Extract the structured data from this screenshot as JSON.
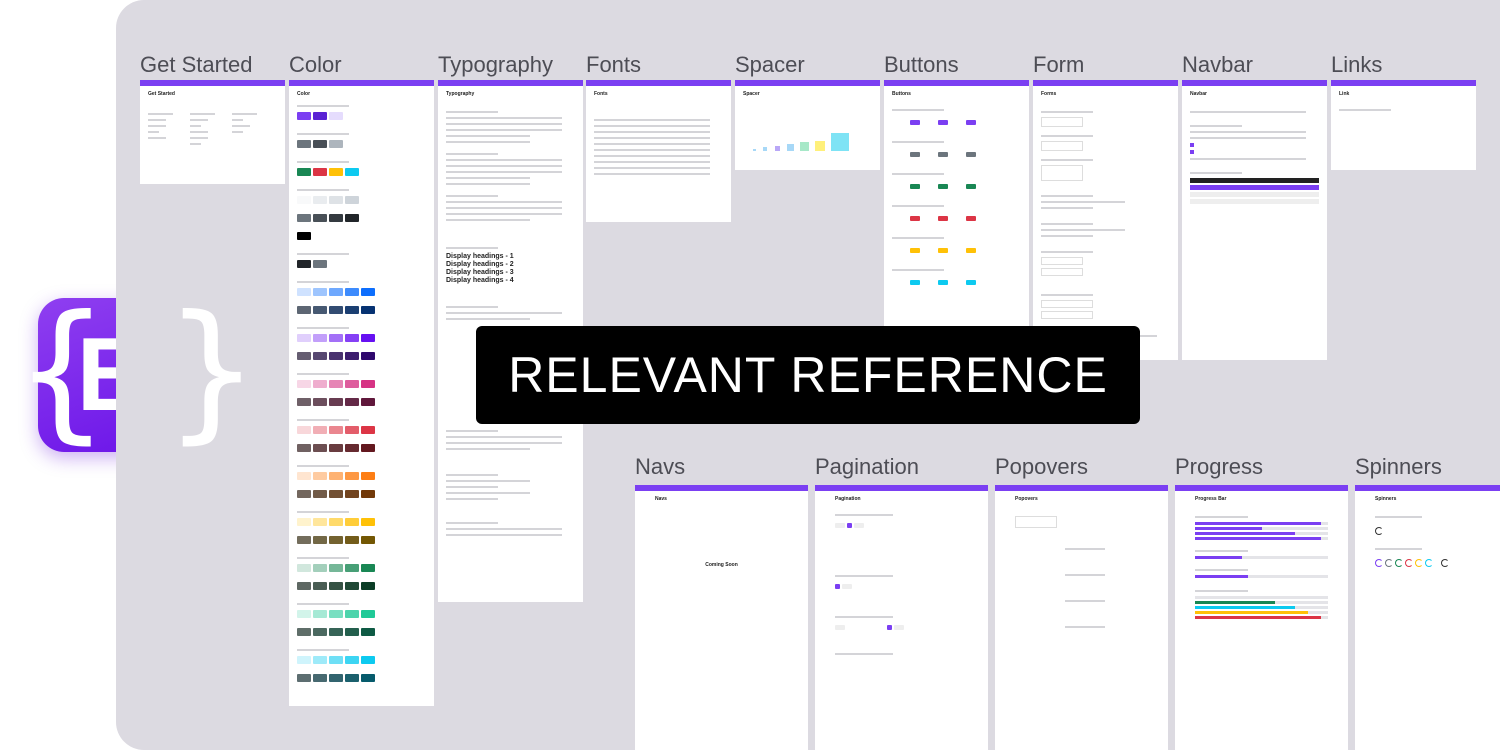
{
  "logo": {
    "letter": "B"
  },
  "banner": {
    "text": "RELEVANT REFERENCE"
  },
  "frames": {
    "get_started": {
      "title": "Get Started",
      "heading": "Get Started"
    },
    "color": {
      "title": "Color",
      "heading": "Color"
    },
    "typography": {
      "title": "Typography",
      "heading": "Typography",
      "display": [
        "Display headings - 1",
        "Display headings - 2",
        "Display headings - 3",
        "Display headings - 4"
      ]
    },
    "fonts": {
      "title": "Fonts",
      "heading": "Fonts"
    },
    "spacer": {
      "title": "Spacer",
      "heading": "Spacer"
    },
    "buttons": {
      "title": "Buttons",
      "heading": "Buttons"
    },
    "form": {
      "title": "Form",
      "heading": "Forms"
    },
    "navbar": {
      "title": "Navbar",
      "heading": "Navbar"
    },
    "links": {
      "title": "Links",
      "heading": "Link"
    },
    "navs": {
      "title": "Navs",
      "heading": "Navs",
      "coming_soon": "Coming Soon"
    },
    "pagination": {
      "title": "Pagination",
      "heading": "Pagination"
    },
    "popovers": {
      "title": "Popovers",
      "heading": "Popovers"
    },
    "progress": {
      "title": "Progress",
      "heading": "Progress Bar",
      "values": [
        0.95,
        0.62,
        0.35
      ]
    },
    "spinners": {
      "title": "Spinners",
      "heading": "Spinners"
    }
  },
  "colors": {
    "accent": "#7b3ff2",
    "primary": [
      "#7b3ff2",
      "#5a22d4",
      "#e5dcfd"
    ],
    "secondary": [
      "#6c757d",
      "#495057",
      "#adb5bd"
    ],
    "status": [
      "#198754",
      "#dc3545",
      "#ffc107",
      "#0dcaf0"
    ],
    "blue": [
      "#cfe2ff",
      "#9ec5fe",
      "#6ea8fe",
      "#3d8bfd",
      "#0d6efd"
    ],
    "indigo": [
      "#e0cffc",
      "#c29ffa",
      "#a370f7",
      "#8540f5",
      "#6610f2"
    ],
    "pink": [
      "#f7d6e6",
      "#efadce",
      "#e685b5",
      "#de5c9d",
      "#d63384"
    ],
    "red": [
      "#f8d7da",
      "#f1aeb5",
      "#ea868f",
      "#e35d6a",
      "#dc3545"
    ],
    "orange": [
      "#ffe5d0",
      "#fecba1",
      "#feb272",
      "#fd9843",
      "#fd7e14"
    ],
    "yellow": [
      "#fff3cd",
      "#ffe69c",
      "#ffda6a",
      "#ffcd39",
      "#ffc107"
    ],
    "green": [
      "#d1e7dd",
      "#a3cfbb",
      "#75b798",
      "#479f76",
      "#198754"
    ],
    "teal": [
      "#d2f4ea",
      "#a6e9d5",
      "#79dfc1",
      "#4dd4ac",
      "#20c997"
    ],
    "cyan": [
      "#cff4fc",
      "#9eeaf9",
      "#6edff6",
      "#3dd5f3",
      "#0dcaf0"
    ]
  }
}
